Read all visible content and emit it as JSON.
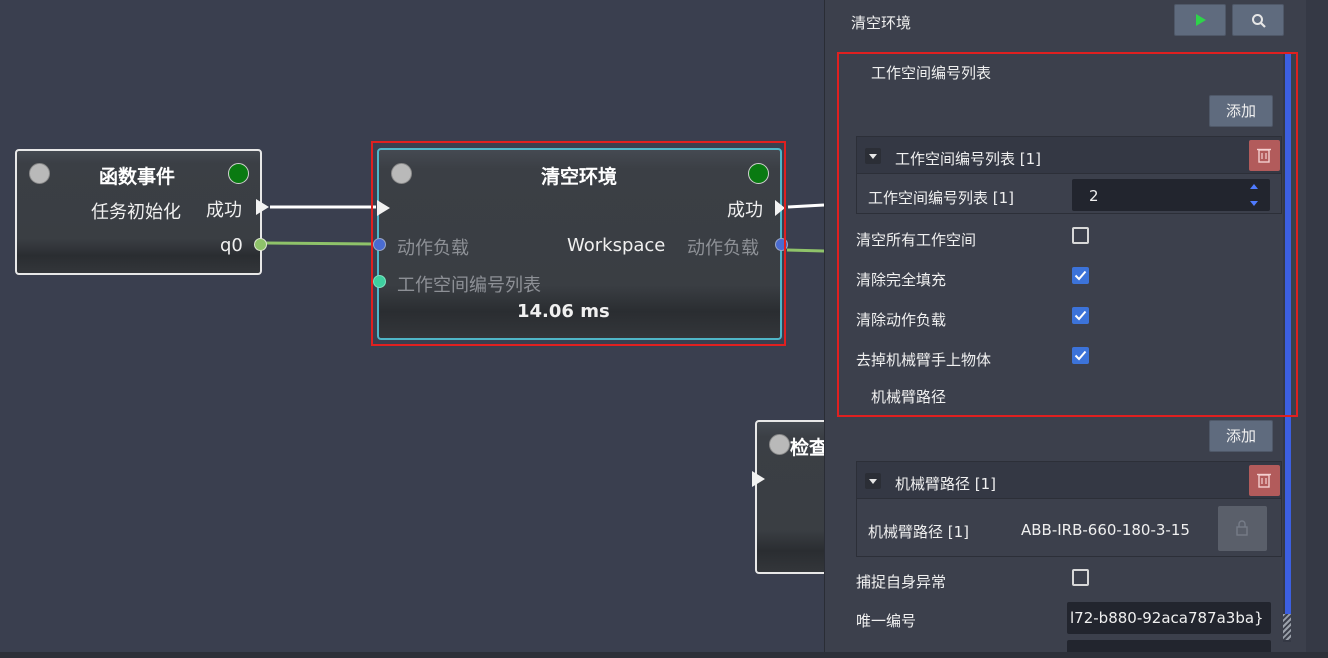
{
  "nodes": {
    "event": {
      "title": "函数事件",
      "out_label": "成功",
      "sub_label": "任务初始化",
      "port_label": "q0"
    },
    "clear": {
      "title": "清空环境",
      "out_label": "成功",
      "in_payload": "动作负载",
      "center_label": "Workspace",
      "out_payload": "动作负载",
      "in_ws_list": "工作空间编号列表",
      "timing": "14.06 ms"
    },
    "check": {
      "title": "检查"
    }
  },
  "panel": {
    "title": "清空环境",
    "play_icon": "play-icon",
    "search_icon": "search-icon",
    "ws_section_label": "工作空间编号列表",
    "add_label": "添加",
    "ws_group": {
      "header": "工作空间编号列表 [1]",
      "row_label": "工作空间编号列表 [1]",
      "value": "2"
    },
    "options": [
      {
        "label": "清空所有工作空间",
        "checked": false
      },
      {
        "label": "清除完全填充",
        "checked": true
      },
      {
        "label": "清除动作负载",
        "checked": true
      },
      {
        "label": "去掉机械臂手上物体",
        "checked": true
      }
    ],
    "arm_section_label": "机械臂路径",
    "arm_add_label": "添加",
    "arm_group": {
      "header": "机械臂路径 [1]",
      "row_label": "机械臂路径 [1]",
      "value": "ABB-IRB-660-180-3-15"
    },
    "catch_label": "捕捉自身异常",
    "catch_checked": false,
    "uid_label": "唯一编号",
    "uid_value": "l72-b880-92aca787a3ba}"
  },
  "colors": {
    "accent_blue": "#3c73d9",
    "selection_red": "#e02020",
    "success_green": "#0a7a12",
    "wire_green": "#8fc36a"
  }
}
